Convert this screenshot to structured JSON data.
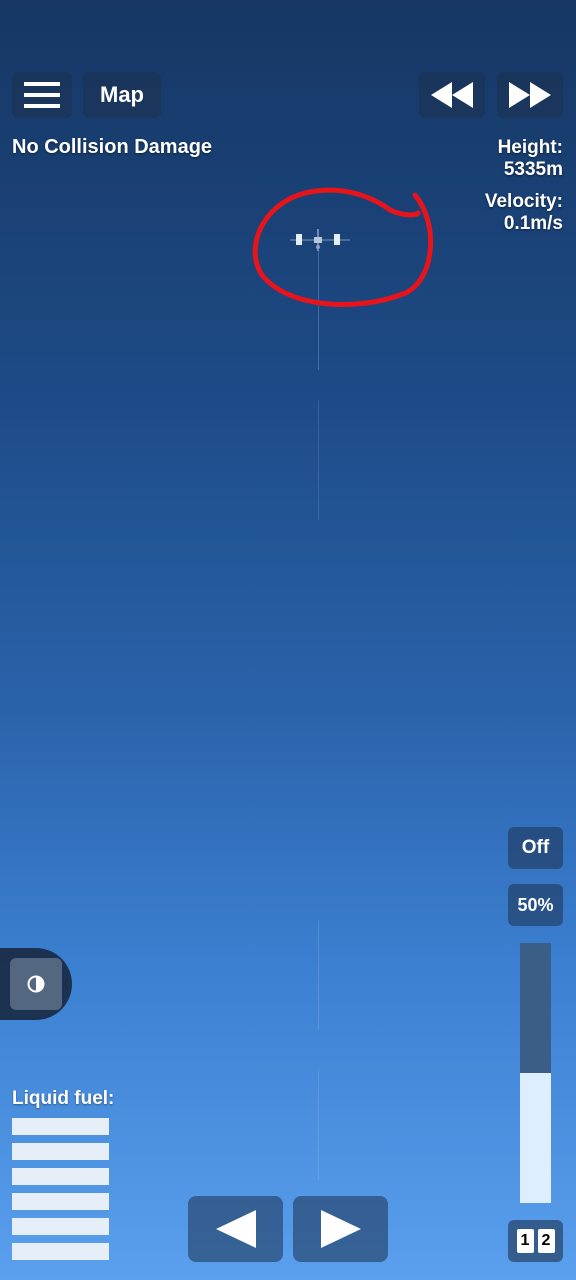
{
  "top_bar": {
    "menu_icon": "hamburger-menu-icon",
    "map_label": "Map",
    "rewind_icon": "rewind-icon",
    "fast_forward_icon": "fast-forward-icon"
  },
  "status": {
    "collision": "No Collision Damage"
  },
  "telemetry": {
    "height_label": "Height:",
    "height_value": "5335m",
    "velocity_label": "Velocity:",
    "velocity_value": "0.1m/s"
  },
  "throttle": {
    "off_label": "Off",
    "percent_label": "50%",
    "level": 0.5
  },
  "side_panel": {
    "icon": "half-circle-contrast-icon"
  },
  "fuel": {
    "label": "Liquid fuel:",
    "bar_count": 6
  },
  "navigation": {
    "prev_icon": "triangle-left-icon",
    "next_icon": "triangle-right-icon"
  },
  "stages": {
    "first": "1",
    "second": "2"
  },
  "colors": {
    "annotation": "#e8141c",
    "throttle_fill": "#dfeeff",
    "throttle_track": "#3a5e86"
  }
}
